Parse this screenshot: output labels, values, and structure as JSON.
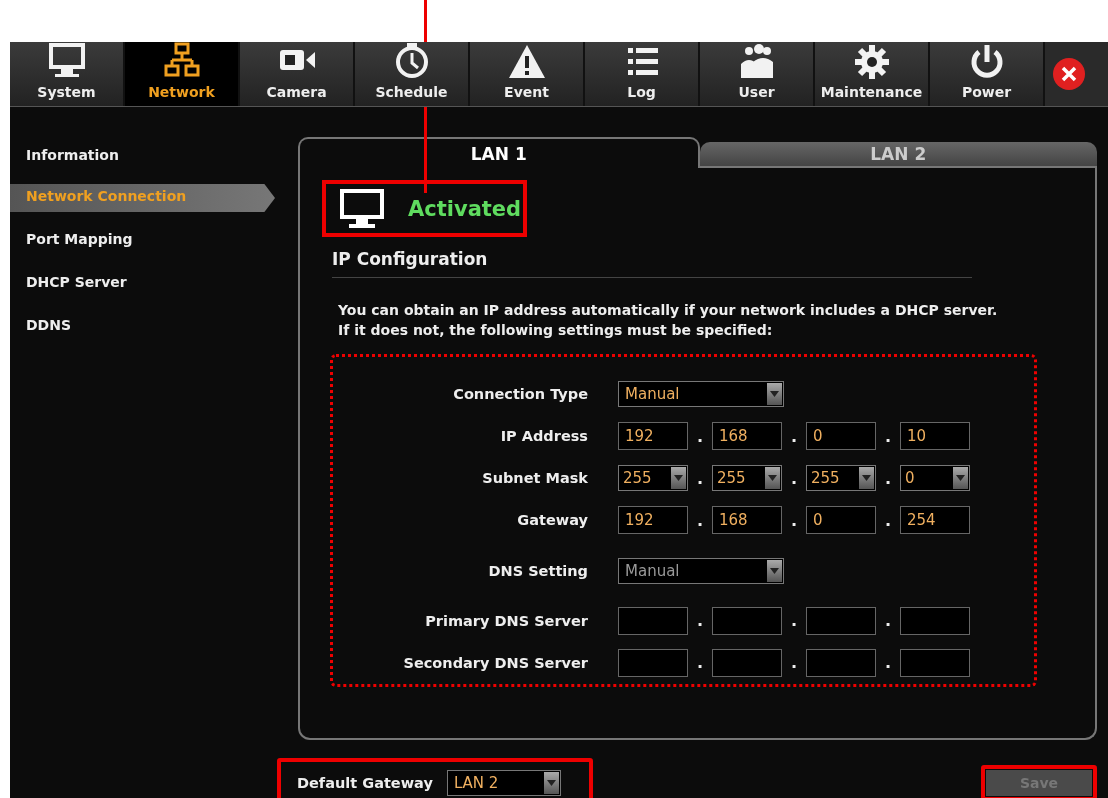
{
  "toolbar": {
    "items": [
      {
        "label": "System",
        "selected": false
      },
      {
        "label": "Network",
        "selected": true
      },
      {
        "label": "Camera",
        "selected": false
      },
      {
        "label": "Schedule",
        "selected": false
      },
      {
        "label": "Event",
        "selected": false
      },
      {
        "label": "Log",
        "selected": false
      },
      {
        "label": "User",
        "selected": false
      },
      {
        "label": "Maintenance",
        "selected": false
      },
      {
        "label": "Power",
        "selected": false
      }
    ]
  },
  "sidebar": {
    "items": [
      {
        "label": "Information",
        "selected": false
      },
      {
        "label": "Network Connection",
        "selected": true
      },
      {
        "label": "Port Mapping",
        "selected": false
      },
      {
        "label": "DHCP Server",
        "selected": false
      },
      {
        "label": "DDNS",
        "selected": false
      }
    ]
  },
  "tabs": [
    {
      "label": "LAN 1",
      "selected": true
    },
    {
      "label": "LAN 2",
      "selected": false
    }
  ],
  "status": {
    "text": "Activated"
  },
  "section_title": "IP Configuration",
  "description": [
    "You can obtain an IP address automatically if your network includes a DHCP server.",
    "If it does not, the following settings must be specified:"
  ],
  "form": {
    "rows": [
      {
        "kind": "select",
        "label": "Connection Type",
        "value": "Manual",
        "disabled": false
      },
      {
        "kind": "ip",
        "label": "IP Address",
        "separator": ".",
        "octets": [
          "192",
          "168",
          "0",
          "10"
        ]
      },
      {
        "kind": "ip_select",
        "label": "Subnet Mask",
        "separator": ".",
        "octets": [
          "255",
          "255",
          "255",
          "0"
        ]
      },
      {
        "kind": "ip",
        "label": "Gateway",
        "separator": ".",
        "octets": [
          "192",
          "168",
          "0",
          "254"
        ]
      },
      {
        "kind": "select",
        "label": "DNS Setting",
        "value": "Manual",
        "disabled": true
      },
      {
        "kind": "ip_empty",
        "label": "Primary DNS Server",
        "separators": [
          ".",
          ".",
          "."
        ]
      },
      {
        "kind": "ip_empty",
        "label": "Secondary DNS Server",
        "separators": [
          ".",
          ".",
          "."
        ]
      }
    ]
  },
  "footer": {
    "default_gateway": {
      "label": "Default Gateway",
      "value": "LAN 2"
    },
    "save_button": {
      "label": "Save",
      "disabled": true
    }
  }
}
